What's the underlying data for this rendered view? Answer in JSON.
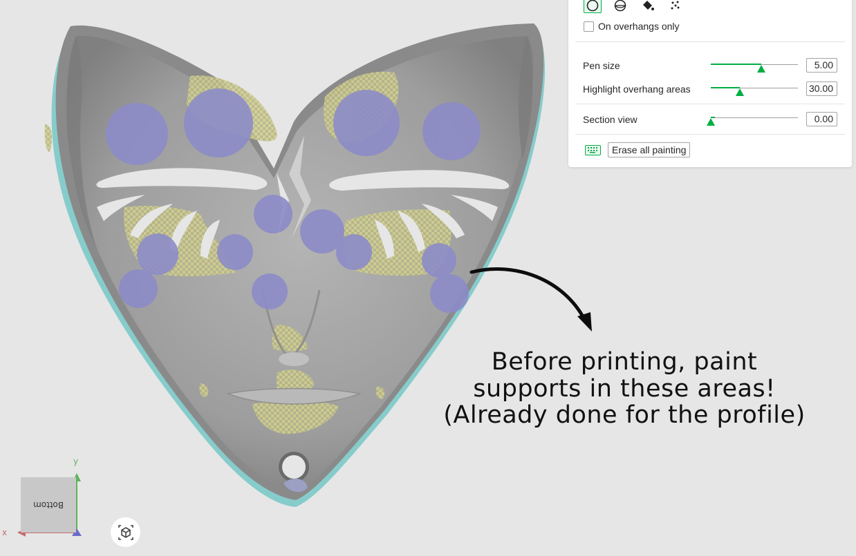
{
  "paint_panel": {
    "tools": [
      {
        "name": "circle",
        "icon": "circle-icon",
        "active": true
      },
      {
        "name": "sphere",
        "icon": "sphere-icon",
        "active": false
      },
      {
        "name": "fill",
        "icon": "fill-bucket-icon",
        "active": false
      },
      {
        "name": "gap-fill",
        "icon": "gap-fill-icon",
        "active": false
      }
    ],
    "overhangs_only_label": "On overhangs only",
    "overhangs_only_checked": false,
    "pen_size": {
      "label": "Pen size",
      "value": "5.00",
      "level": 0.58
    },
    "highlight_overhang": {
      "label": "Highlight overhang areas",
      "value": "30.00",
      "level": 0.33
    },
    "section_view": {
      "label": "Section view",
      "value": "0.00",
      "level": 0.0
    },
    "erase_all_label": "Erase all painting",
    "accent_color": "#00ae42"
  },
  "annotation": {
    "line1": "Before printing, paint",
    "line2": "supports in these areas!",
    "line3": "(Already done for the profile)"
  },
  "view_cube": {
    "face_label": "Bottom",
    "x_axis_label": "x",
    "y_axis_label": "y"
  },
  "colors": {
    "background": "#e6e6e6",
    "mask_gray": "#9a9a9a",
    "mask_rim": "#86cccb",
    "support_paint": "#8c8cc8",
    "overhang_highlight": "#c8c878"
  }
}
